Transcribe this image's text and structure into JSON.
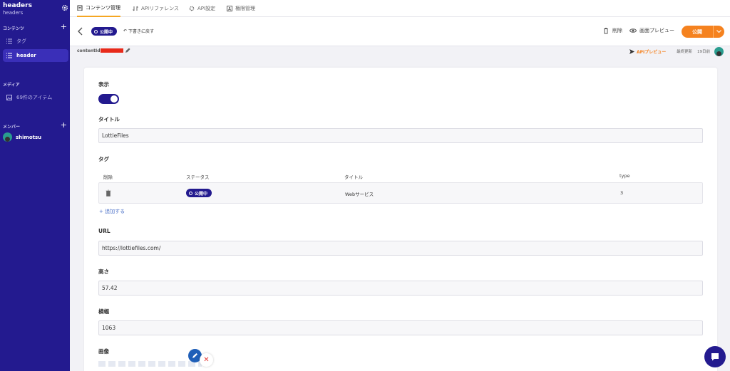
{
  "sidebar": {
    "title": "headers",
    "subtitle": "headers",
    "section_content": "コンテンツ",
    "items": [
      {
        "label": "タグ"
      },
      {
        "label": "header"
      }
    ],
    "section_media": "メディア",
    "media_item": "69件のアイテム",
    "section_members": "メンバー",
    "member_name": "shimotsu"
  },
  "tabs": [
    {
      "label": "コンテンツ管理"
    },
    {
      "label": "APIリファレンス"
    },
    {
      "label": "API設定"
    },
    {
      "label": "権限管理"
    }
  ],
  "actionbar": {
    "status": "公開中",
    "revert": "下書きに戻す",
    "delete": "削除",
    "preview": "画面プレビュー",
    "publish": "公開"
  },
  "meta": {
    "content_id_label": "contentId",
    "api_preview": "APIプレビュー",
    "updated_label": "最終更新",
    "updated_value": "19日前"
  },
  "form": {
    "display_label": "表示",
    "display_on": true,
    "title_label": "タイトル",
    "title_value": "LottieFiles",
    "tag_label": "タグ",
    "table": {
      "headers": [
        "削除",
        "ステータス",
        "タイトル",
        "type"
      ],
      "row": {
        "status": "公開中",
        "title": "Webサービス",
        "type": "3"
      }
    },
    "add_label": "+ 追加する",
    "url_label": "URL",
    "url_value": "https://lottiefiles.com/",
    "height_label": "高さ",
    "height_value": "57.42",
    "width_label": "横幅",
    "width_value": "1063",
    "image_label": "画像"
  },
  "colors": {
    "sidebar": "#231a8f",
    "accent": "#f5821f",
    "active_tab": "#f5a623"
  }
}
